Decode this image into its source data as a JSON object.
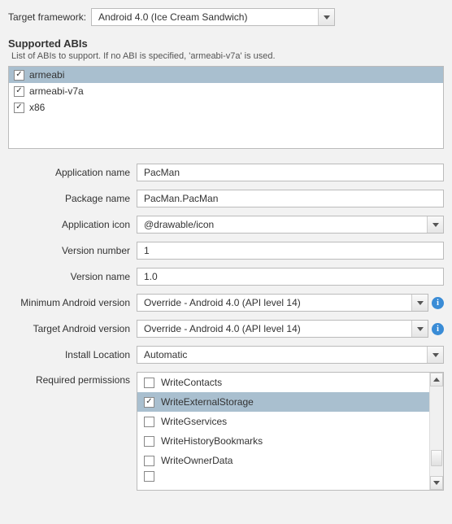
{
  "target_framework": {
    "label": "Target framework:",
    "value": "Android 4.0 (Ice Cream Sandwich)"
  },
  "abis": {
    "title": "Supported ABIs",
    "desc": "List of ABIs to support. If no ABI is specified, 'armeabi-v7a' is used.",
    "items": [
      {
        "label": "armeabi",
        "checked": true,
        "selected": true
      },
      {
        "label": "armeabi-v7a",
        "checked": true,
        "selected": false
      },
      {
        "label": "x86",
        "checked": true,
        "selected": false
      }
    ]
  },
  "form": {
    "application_name": {
      "label": "Application name",
      "value": "PacMan"
    },
    "package_name": {
      "label": "Package name",
      "value": "PacMan.PacMan"
    },
    "application_icon": {
      "label": "Application icon",
      "value": "@drawable/icon"
    },
    "version_number": {
      "label": "Version number",
      "value": "1"
    },
    "version_name": {
      "label": "Version name",
      "value": "1.0"
    },
    "min_version": {
      "label": "Minimum Android version",
      "value": "Override - Android 4.0 (API level 14)"
    },
    "target_version": {
      "label": "Target Android version",
      "value": "Override - Android 4.0 (API level 14)"
    },
    "install_location": {
      "label": "Install Location",
      "value": "Automatic"
    },
    "required_permissions": {
      "label": "Required permissions"
    }
  },
  "permissions": [
    {
      "label": "WriteContacts",
      "checked": false,
      "selected": false
    },
    {
      "label": "WriteExternalStorage",
      "checked": true,
      "selected": true
    },
    {
      "label": "WriteGservices",
      "checked": false,
      "selected": false
    },
    {
      "label": "WriteHistoryBookmarks",
      "checked": false,
      "selected": false
    },
    {
      "label": "WriteOwnerData",
      "checked": false,
      "selected": false
    }
  ]
}
